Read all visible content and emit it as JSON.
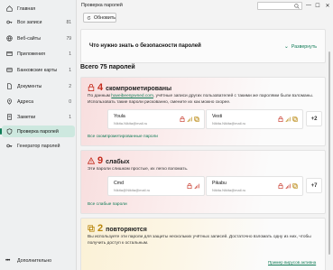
{
  "sidebar": {
    "items": [
      {
        "label": "Главная",
        "count": "",
        "icon": "home-icon"
      },
      {
        "label": "Все записи",
        "count": "81",
        "icon": "key-icon"
      },
      {
        "label": "Веб-сайты",
        "count": "79",
        "icon": "globe-icon"
      },
      {
        "label": "Приложения",
        "count": "1",
        "icon": "apps-icon"
      },
      {
        "label": "Банковские карты",
        "count": "1",
        "icon": "card-icon"
      },
      {
        "label": "Документы",
        "count": "2",
        "icon": "document-icon"
      },
      {
        "label": "Адреса",
        "count": "0",
        "icon": "location-icon"
      },
      {
        "label": "Заметки",
        "count": "1",
        "icon": "note-icon"
      },
      {
        "label": "Проверка паролей",
        "count": "",
        "icon": "shield-icon"
      },
      {
        "label": "Генератор паролей",
        "count": "",
        "icon": "key-generator-icon"
      }
    ],
    "more_label": "Дополнительно"
  },
  "titlebar": {
    "title": "Проверка паролей",
    "search_placeholder": ""
  },
  "toolbar": {
    "refresh_label": "Обновить"
  },
  "info": {
    "question": "Что нужно знать о безопасности паролей",
    "expand_label": "Развернуть"
  },
  "summary": {
    "total_label": "Всего 75 паролей"
  },
  "groups": {
    "compromised": {
      "count": "4",
      "label": "скомпрометированы",
      "desc_before": "По данным ",
      "desc_link": "haveibeenpwned.com",
      "desc_after": ", учётные записи других пользователей с такими же паролями были взломаны. Использовать такие пароли рискованно, смените их как можно скорее.",
      "accounts": [
        {
          "name": "Youla",
          "email": "Nikita.Nikita@mail.ru"
        },
        {
          "name": "Vesti",
          "email": "Nikita.Nikita@mail.ru"
        }
      ],
      "more": "+2",
      "link": "Все скомпрометированные пароли"
    },
    "weak": {
      "count": "9",
      "label": "слабых",
      "desc": "Эти пароли слишком простые, их легко взломать.",
      "accounts": [
        {
          "name": "Cmd",
          "email": "Nikita@Nikita@mail.ru"
        },
        {
          "name": "Pikabu",
          "email": "Nikita.Nikita@mail.ru"
        }
      ],
      "more": "+7",
      "link": "Все слабые пароли"
    },
    "reused": {
      "count": "2",
      "label": "повторяются",
      "desc": "Вы используете эти пароли для защиты нескольких учётных записей. Достаточно взломать одну из них, чтобы получить доступ к остальным."
    }
  },
  "footer": {
    "example_label": "Пример вирусов активна"
  },
  "colors": {
    "accent": "#0e7a55",
    "danger": "#c42b1c",
    "warning": "#b8860b"
  }
}
